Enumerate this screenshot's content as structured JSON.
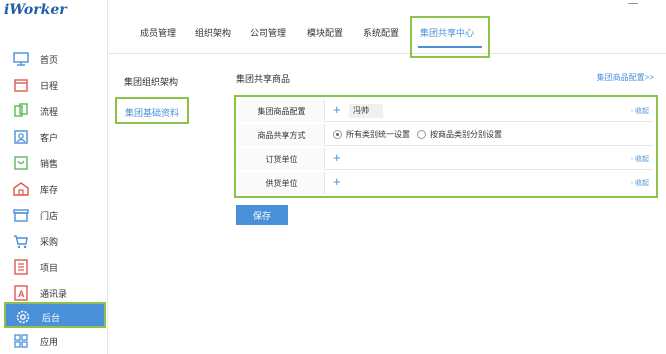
{
  "app": {
    "logo": "iWorker"
  },
  "sidebar": {
    "items": [
      {
        "label": "首页",
        "icon": "monitor-icon"
      },
      {
        "label": "日程",
        "icon": "calendar-icon"
      },
      {
        "label": "流程",
        "icon": "workflow-icon"
      },
      {
        "label": "客户",
        "icon": "customer-icon"
      },
      {
        "label": "销售",
        "icon": "sales-icon"
      },
      {
        "label": "库存",
        "icon": "warehouse-icon"
      },
      {
        "label": "门店",
        "icon": "store-icon"
      },
      {
        "label": "采购",
        "icon": "cart-icon"
      },
      {
        "label": "项目",
        "icon": "project-icon"
      },
      {
        "label": "通讯录",
        "icon": "contacts-icon"
      },
      {
        "label": "后台",
        "icon": "gear-icon",
        "active": true
      },
      {
        "label": "应用",
        "icon": "apps-grid-icon"
      }
    ]
  },
  "tabs": [
    {
      "label": "成员管理"
    },
    {
      "label": "组织架构"
    },
    {
      "label": "公司管理"
    },
    {
      "label": "模块配置"
    },
    {
      "label": "系统配置"
    },
    {
      "label": "集团共享中心",
      "active": true
    }
  ],
  "subnav": [
    {
      "label": "集团组织架构"
    },
    {
      "label": "集团基础资料",
      "active": true
    }
  ],
  "panel": {
    "title": "集团共享商品",
    "link": "集团商品配置>>",
    "rows": [
      {
        "label": "集团商品配置",
        "tag": "冯帅",
        "collapse": "- 收起"
      },
      {
        "label": "商品共享方式",
        "options": [
          "所有类别统一设置",
          "按商品类别分别设置"
        ],
        "selected": 0
      },
      {
        "label": "订货单位",
        "collapse": "- 收起"
      },
      {
        "label": "供货单位",
        "collapse": "- 收起"
      }
    ],
    "save_label": "保存"
  },
  "colors": {
    "accent": "#4a90d9",
    "highlight": "#8bc34a"
  }
}
